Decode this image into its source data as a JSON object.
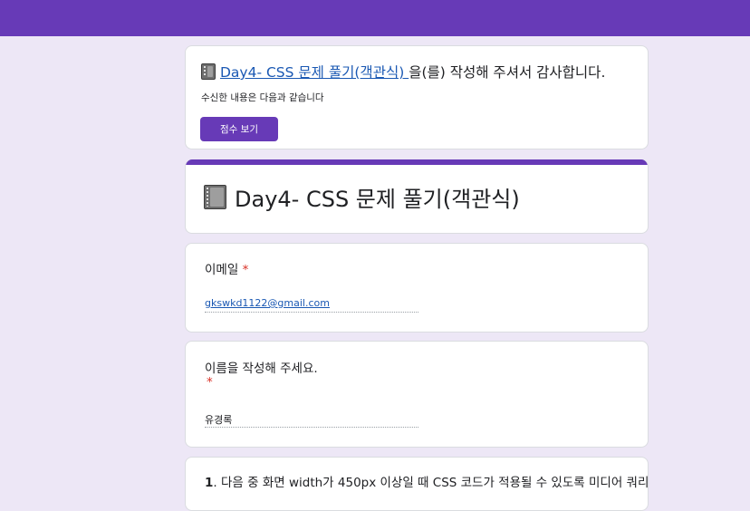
{
  "form": {
    "title": "Day4- CSS 문제 풀기(객관식)",
    "title_icon": "notebook-icon",
    "accent_color": "#673ab7",
    "background_color": "#ede7f6"
  },
  "confirmation": {
    "link_text": "Day4- CSS 문제 풀기(객관식) ",
    "suffix_text": "을(를) 작성해 주셔서 감사합니다.",
    "received_text": "수신한 내용은 다음과 같습니다",
    "score_button_label": "점수 보기"
  },
  "questions": [
    {
      "label": "이메일",
      "required_mark": "*",
      "answer": "gkswkd1122@gmail.com"
    },
    {
      "label": "이름을 작성해 주세요.",
      "required_mark": "*",
      "answer": "유경록"
    },
    {
      "number": "1",
      "text": ". 다음 중 화면 width가 450px 이상일 때 CSS 코드가 적용될 수 있도록 미디어 쿼리"
    }
  ]
}
